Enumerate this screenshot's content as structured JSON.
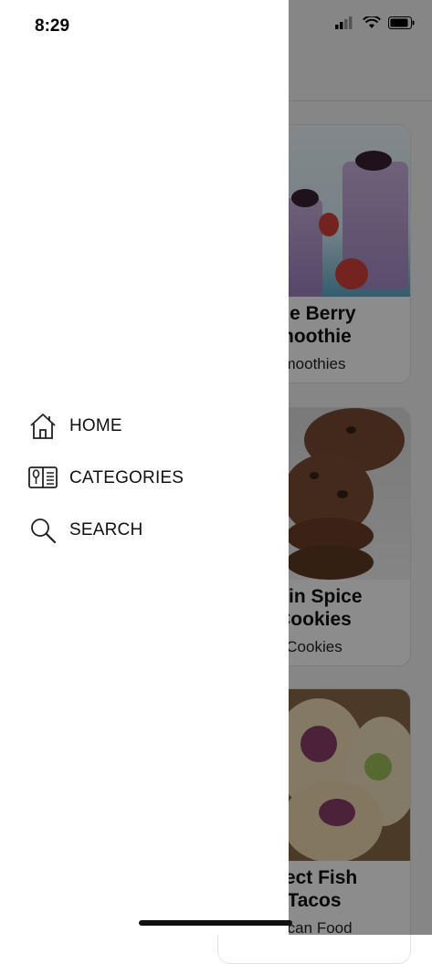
{
  "status_bar": {
    "time": "8:29"
  },
  "drawer": {
    "menu": [
      {
        "label": "HOME",
        "icon": "home-icon"
      },
      {
        "label": "CATEGORIES",
        "icon": "recipe-book-icon"
      },
      {
        "label": "SEARCH",
        "icon": "search-icon"
      }
    ]
  },
  "cards": [
    {
      "title_line1": "ple Berry",
      "title_line2": "moothie",
      "category": "moothies"
    },
    {
      "title_line1": "pkin Spice",
      "title_line2": "Cookies",
      "category": "Cookies"
    },
    {
      "title_line1": "rfect Fish",
      "title_line2": "Tacos",
      "category": "xican Food"
    }
  ],
  "colors": {
    "overlay": "#000000",
    "drawer_bg": "#ffffff",
    "text": "#111111"
  }
}
